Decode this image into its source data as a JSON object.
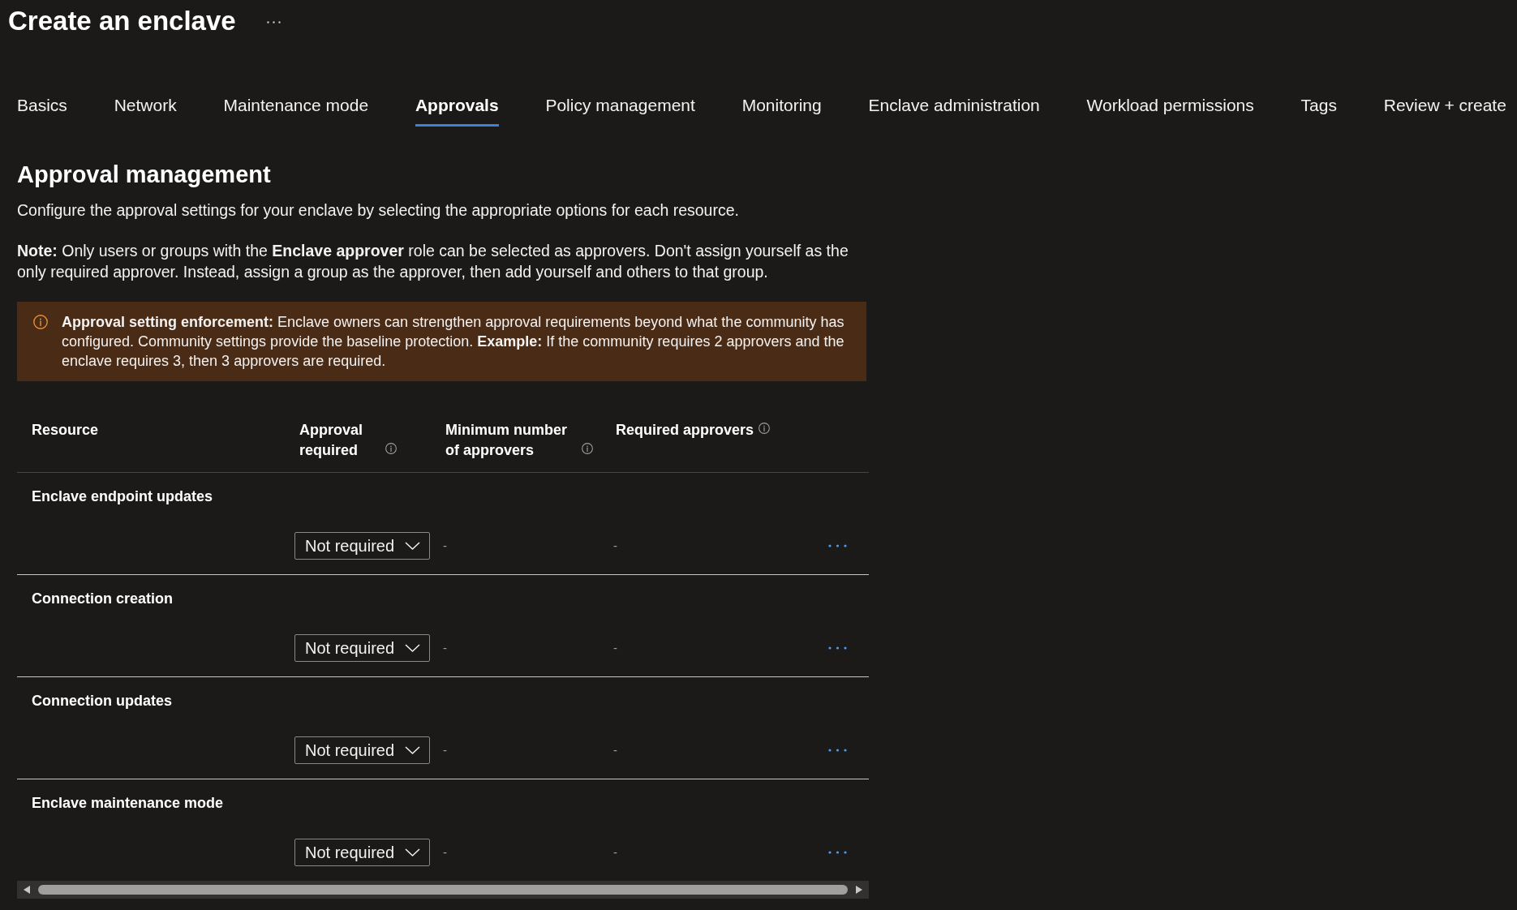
{
  "header": {
    "title": "Create an enclave"
  },
  "tabs": [
    {
      "label": "Basics",
      "selected": false
    },
    {
      "label": "Network",
      "selected": false
    },
    {
      "label": "Maintenance mode",
      "selected": false
    },
    {
      "label": "Approvals",
      "selected": true
    },
    {
      "label": "Policy management",
      "selected": false
    },
    {
      "label": "Monitoring",
      "selected": false
    },
    {
      "label": "Enclave administration",
      "selected": false
    },
    {
      "label": "Workload permissions",
      "selected": false
    },
    {
      "label": "Tags",
      "selected": false
    },
    {
      "label": "Review + create",
      "selected": false
    }
  ],
  "section": {
    "heading": "Approval management",
    "description": "Configure the approval settings for your enclave by selecting the appropriate options for each resource.",
    "note": "**Note:** Only users or groups with the **Enclave approver** role can be selected as approvers. Don't assign yourself as the only required approver. Instead, assign a group as the approver, then add yourself and others to that group.",
    "alert": {
      "kind": "warning",
      "text": "**Approval setting enforcement:** Enclave owners can strengthen approval requirements beyond what the community has configured. Community settings provide the baseline protection. **Example:** If the community requires 2 approvers and the enclave requires 3, then 3 approvers are required."
    }
  },
  "table": {
    "columns": [
      {
        "label": "Resource",
        "info_icon": false
      },
      {
        "label": "Approval required",
        "info_icon": true
      },
      {
        "label": "Minimum number of approvers",
        "info_icon": true
      },
      {
        "label": "Required approvers",
        "info_icon": true
      }
    ],
    "rows": [
      {
        "resource": "Enclave endpoint updates",
        "approval_required": "Not required",
        "minimum_approvers": "-",
        "required_approvers": "-"
      },
      {
        "resource": "Connection creation",
        "approval_required": "Not required",
        "minimum_approvers": "-",
        "required_approvers": "-"
      },
      {
        "resource": "Connection updates",
        "approval_required": "Not required",
        "minimum_approvers": "-",
        "required_approvers": "-"
      },
      {
        "resource": "Enclave maintenance mode",
        "approval_required": "Not required",
        "minimum_approvers": "-",
        "required_approvers": "-"
      }
    ]
  }
}
